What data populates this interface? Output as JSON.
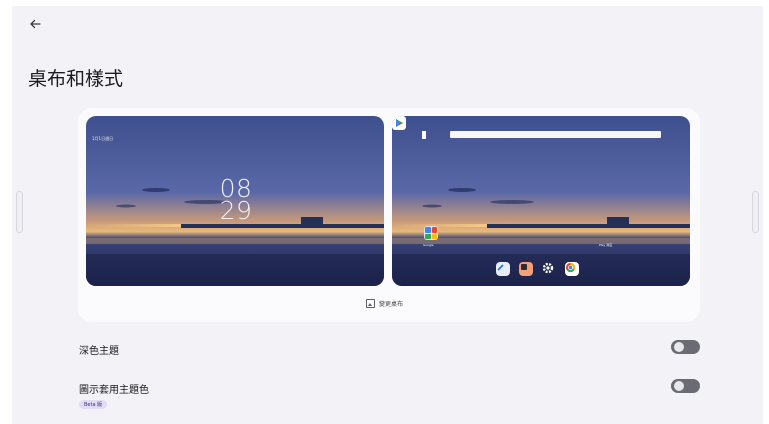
{
  "header": {
    "back_icon": "arrow-left-icon",
    "title": "桌布和樣式"
  },
  "preview": {
    "lock_screen": {
      "status_text": "1月1日週日",
      "clock_hour": "08",
      "clock_minute": "29"
    },
    "home_screen": {
      "folder_label": "Google",
      "play_store_label": "Play 商店",
      "dock_icons": [
        "pencil-icon",
        "calculator-icon",
        "settings-icon",
        "chrome-icon"
      ]
    }
  },
  "change_wallpaper": {
    "icon": "wallpaper-icon",
    "label": "變更桌布"
  },
  "settings": [
    {
      "label": "深色主題",
      "enabled": false
    },
    {
      "label": "圖示套用主題色",
      "badge": "Beta 版",
      "enabled": false
    }
  ],
  "colors": {
    "background": "#f3f2f7",
    "card": "#fbfbfd",
    "toggle_off": "#6b6b73",
    "badge_bg": "#e2dcf8"
  }
}
